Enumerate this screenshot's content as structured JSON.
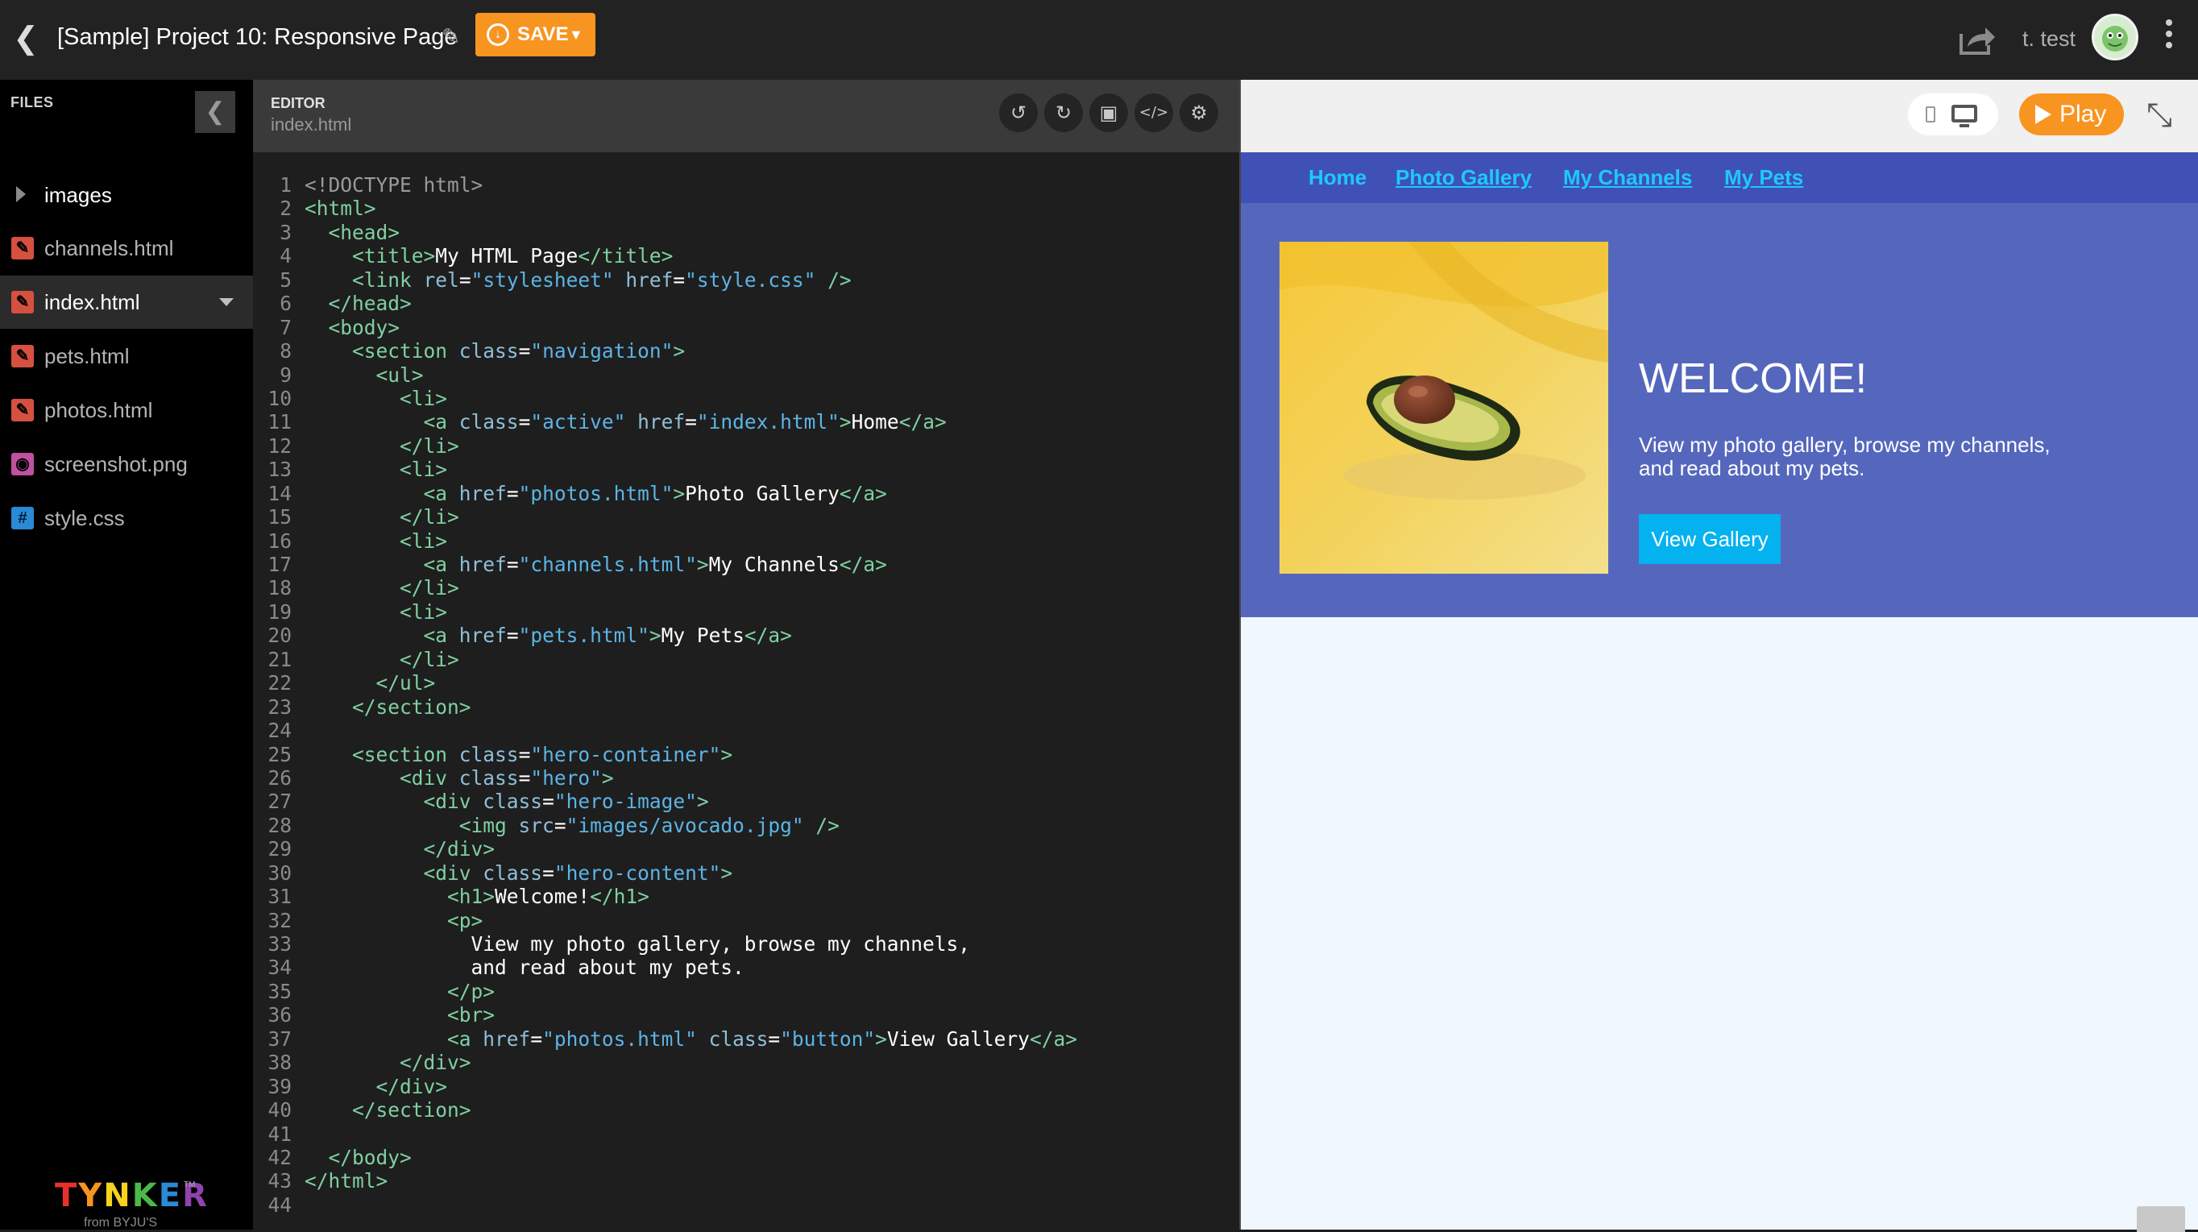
{
  "topbar": {
    "project_title": "[Sample] Project 10: Responsive Page",
    "save_label": "SAVE",
    "user_name": "t. test"
  },
  "files": {
    "header": "FILES",
    "items": [
      {
        "label": "images",
        "type": "folder"
      },
      {
        "label": "channels.html",
        "type": "html"
      },
      {
        "label": "index.html",
        "type": "html",
        "active": true
      },
      {
        "label": "pets.html",
        "type": "html"
      },
      {
        "label": "photos.html",
        "type": "html"
      },
      {
        "label": "screenshot.png",
        "type": "png"
      },
      {
        "label": "style.css",
        "type": "css"
      }
    ],
    "logo_text": "TYNKER",
    "logo_sub": "from BYJU'S"
  },
  "editor": {
    "label": "EDITOR",
    "file": "index.html",
    "code_lines": [
      "<!DOCTYPE html>",
      "<html>",
      "  <head>",
      "    <title>My HTML Page</title>",
      "    <link rel=\"stylesheet\" href=\"style.css\" />",
      "  </head>",
      "  <body>",
      "    <section class=\"navigation\">",
      "      <ul>",
      "        <li>",
      "          <a class=\"active\" href=\"index.html\">Home</a>",
      "        </li>",
      "        <li>",
      "          <a href=\"photos.html\">Photo Gallery</a>",
      "        </li>",
      "        <li>",
      "          <a href=\"channels.html\">My Channels</a>",
      "        </li>",
      "        <li>",
      "          <a href=\"pets.html\">My Pets</a>",
      "        </li>",
      "      </ul>",
      "    </section>",
      "",
      "    <section class=\"hero-container\">",
      "        <div class=\"hero\">",
      "          <div class=\"hero-image\">",
      "             <img src=\"images/avocado.jpg\" />",
      "          </div>",
      "          <div class=\"hero-content\">",
      "            <h1>Welcome!</h1>",
      "            <p>",
      "              View my photo gallery, browse my channels,",
      "              and read about my pets.",
      "            </p>",
      "            <br>",
      "            <a href=\"photos.html\" class=\"button\">View Gallery</a>",
      "        </div>",
      "      </div>",
      "    </section>",
      "",
      "  </body>",
      "</html>",
      ""
    ]
  },
  "preview": {
    "play_label": "Play",
    "nav": [
      "Home",
      "Photo Gallery",
      "My Channels",
      "My Pets"
    ],
    "hero_title": "WELCOME!",
    "hero_text": "View my photo gallery, browse my channels, and read about my pets.",
    "button_label": "View Gallery"
  },
  "colors": {
    "accent": "#f89420",
    "nav_bg": "#3f51b5",
    "hero_bg": "#5567bd",
    "link": "#1ec8ff",
    "button_bg": "#03b2ef"
  }
}
